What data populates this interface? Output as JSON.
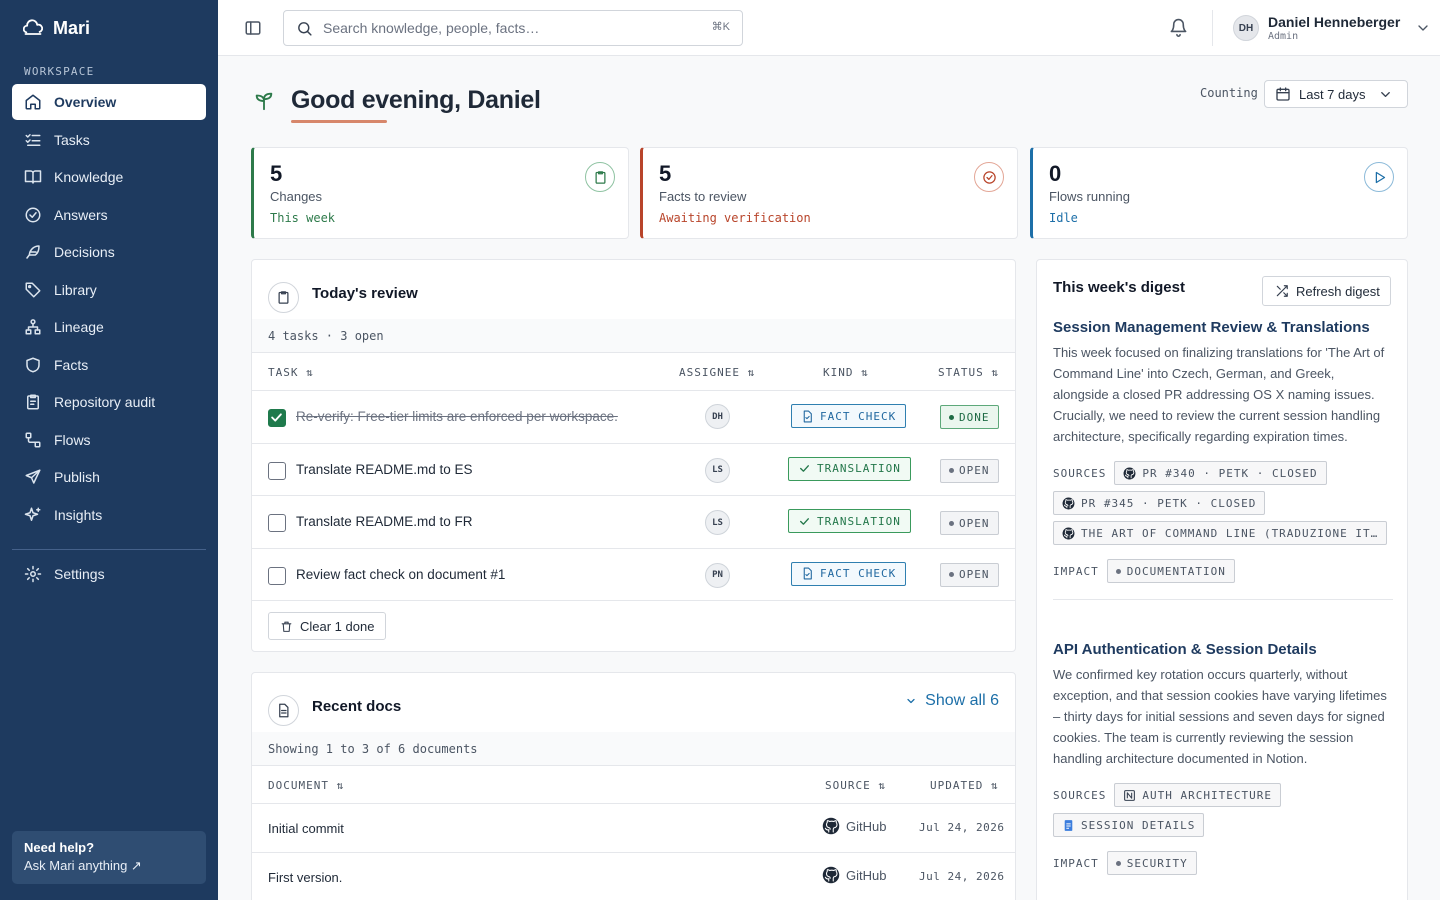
{
  "app": {
    "name": "Mari"
  },
  "sidebar": {
    "section_label": "WORKSPACE",
    "items": [
      {
        "label": "Overview",
        "icon": "home-icon"
      },
      {
        "label": "Tasks",
        "icon": "list-check-icon"
      },
      {
        "label": "Knowledge",
        "icon": "book-icon"
      },
      {
        "label": "Answers",
        "icon": "check-circle-icon"
      },
      {
        "label": "Decisions",
        "icon": "feather-icon"
      },
      {
        "label": "Library",
        "icon": "tag-icon"
      },
      {
        "label": "Lineage",
        "icon": "hierarchy-icon"
      },
      {
        "label": "Facts",
        "icon": "shield-icon"
      },
      {
        "label": "Repository audit",
        "icon": "clipboard-icon"
      },
      {
        "label": "Flows",
        "icon": "flow-icon"
      },
      {
        "label": "Publish",
        "icon": "send-icon"
      },
      {
        "label": "Insights",
        "icon": "sparkle-icon"
      }
    ],
    "settings_label": "Settings",
    "help": {
      "title": "Need help?",
      "link": "Ask Mari anything ↗"
    }
  },
  "topbar": {
    "search_placeholder": "Search knowledge, people, facts…",
    "shortcut": "⌘K",
    "user": {
      "initials": "DH",
      "name": "Daniel Henneberger",
      "role": "Admin"
    }
  },
  "greeting": "Good evening, Daniel",
  "counting_label": "Counting",
  "range": "Last 7 days",
  "stats": [
    {
      "value": "5",
      "label": "Changes",
      "sub": "This week",
      "color": "#2d7a4a",
      "icon": "clipboard-icon"
    },
    {
      "value": "5",
      "label": "Facts to review",
      "sub": "Awaiting verification",
      "color": "#b8442a",
      "icon": "check-circle-icon"
    },
    {
      "value": "0",
      "label": "Flows running",
      "sub": "Idle",
      "color": "#1d6fa8",
      "icon": "play-icon"
    }
  ],
  "review": {
    "title": "Today's review",
    "meta": "4 tasks · 3 open",
    "columns": {
      "task": "TASK",
      "assignee": "ASSIGNEE",
      "kind": "KIND",
      "status": "STATUS"
    },
    "rows": [
      {
        "task": "Re-verify: Free-tier limits are enforced per workspace.",
        "assignee": "DH",
        "kind": "FACT CHECK",
        "status": "DONE",
        "done": true
      },
      {
        "task": "Translate README.md to ES",
        "assignee": "LS",
        "kind": "TRANSLATION",
        "status": "OPEN",
        "done": false
      },
      {
        "task": "Translate README.md to FR",
        "assignee": "LS",
        "kind": "TRANSLATION",
        "status": "OPEN",
        "done": false
      },
      {
        "task": "Review fact check on document #1",
        "assignee": "PN",
        "kind": "FACT CHECK",
        "status": "OPEN",
        "done": false
      }
    ],
    "clear_label": "Clear 1 done"
  },
  "docs": {
    "title": "Recent docs",
    "show_all": "Show all 6",
    "meta": "Showing 1 to 3 of 6 documents",
    "columns": {
      "document": "DOCUMENT",
      "source": "SOURCE",
      "updated": "UPDATED"
    },
    "rows": [
      {
        "name": "Initial commit",
        "source": "GitHub",
        "updated": "Jul 24, 2026"
      },
      {
        "name": "First version.",
        "source": "GitHub",
        "updated": "Jul 24, 2026"
      }
    ]
  },
  "digest": {
    "title": "This week's digest",
    "refresh_label": "Refresh digest",
    "sources_label": "SOURCES",
    "impact_label": "IMPACT",
    "sections": [
      {
        "title": "Session Management Review & Translations",
        "body": "This week focused on finalizing translations for 'The Art of Command Line' into Czech, German, and Greek, alongside a closed PR addressing OS X naming issues. Crucially, we need to review the current session handling architecture, specifically regarding expiration times.",
        "sources": [
          {
            "label": "PR #340 · PETK · CLOSED",
            "icon": "github-icon"
          },
          {
            "label": "PR #345 · PETK · CLOSED",
            "icon": "github-icon"
          },
          {
            "label": "THE ART OF COMMAND LINE (TRADUZIONE ITALIANA)",
            "icon": "github-icon"
          }
        ],
        "impact": "DOCUMENTATION"
      },
      {
        "title": "API Authentication & Session Details",
        "body": "We confirmed key rotation occurs quarterly, without exception, and that session cookies have varying lifetimes – thirty days for initial sessions and seven days for signed cookies. The team is currently reviewing the session handling architecture documented in Notion.",
        "sources": [
          {
            "label": "AUTH ARCHITECTURE",
            "icon": "notion-icon"
          },
          {
            "label": "SESSION DETAILS",
            "icon": "google-doc-icon"
          }
        ],
        "impact": "SECURITY"
      }
    ]
  }
}
